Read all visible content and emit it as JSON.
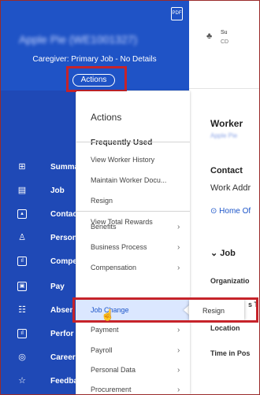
{
  "profile": {
    "pdf_label": "PDF",
    "worker_name": "Apple Pie (WE1001327)",
    "caregiver_line": "Caregiver: Primary Job - No Details",
    "actions_button": "Actions"
  },
  "sidebar": {
    "items": [
      {
        "label": "Summa",
        "icon": "grid-icon",
        "glyph": "⊞"
      },
      {
        "label": "Job",
        "icon": "job-icon",
        "glyph": "▤"
      },
      {
        "label": "Contac",
        "icon": "contact-icon",
        "glyph": "▴"
      },
      {
        "label": "Person",
        "icon": "person-icon",
        "glyph": "♙"
      },
      {
        "label": "Compe",
        "icon": "compensation-icon",
        "glyph": "ıl"
      },
      {
        "label": "Pay",
        "icon": "pay-icon",
        "glyph": "▣"
      },
      {
        "label": "Absen",
        "icon": "absence-icon",
        "glyph": "☷"
      },
      {
        "label": "Perfor",
        "icon": "performance-icon",
        "glyph": "ıl"
      },
      {
        "label": "Career",
        "icon": "career-icon",
        "glyph": "◎"
      },
      {
        "label": "Feedba",
        "icon": "feedback-icon",
        "glyph": "☆"
      }
    ]
  },
  "right_panel": {
    "top_su": "Su",
    "top_cd": "CD",
    "worker_heading": "Worker",
    "worker_link": "Apple Pie",
    "contact_heading": "Contact",
    "work_address": "Work Addr",
    "home_office": "Home Of",
    "job_section": "Job",
    "organization": "Organizatio",
    "s_t": "s T",
    "location": "Location",
    "time_in_pos": "Time in Pos"
  },
  "actions_menu": {
    "heading": "Actions",
    "frequently_used": "Frequently Used",
    "frequent_items": [
      "View Worker History",
      "Maintain Worker Docu...",
      "Resign",
      "View Total Rewards"
    ],
    "categories": [
      "Benefits",
      "Business Process",
      "Compensation",
      "Job Change",
      "Payment",
      "Payroll",
      "Personal Data",
      "Procurement"
    ],
    "submenu": {
      "resign": "Resign"
    }
  },
  "colors": {
    "sidebar_blue": "#1f49b6",
    "header_blue": "#1f53c6",
    "highlight_red": "#c6232a",
    "link_blue": "#1c55c9"
  }
}
